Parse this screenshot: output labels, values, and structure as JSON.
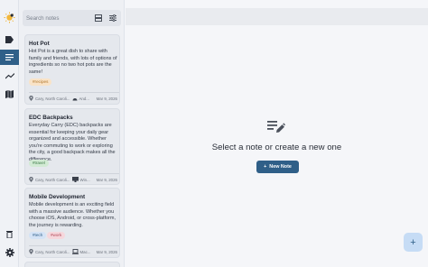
{
  "search": {
    "placeholder": "Search notes"
  },
  "notes": [
    {
      "title": "Hot Pot",
      "body": "Hot Pot is a great dish to share with family and friends, with lots of options of ingredients so no two hot pots are the same!",
      "tags": [
        {
          "label": "#recipes",
          "bg": "#f9e3c7",
          "fg": "#b0762c"
        }
      ],
      "location": "Cary, North Caroli...",
      "device": "And...",
      "date": "Mar 9, 2026"
    },
    {
      "title": "EDC Backpacks",
      "body": "Everyday Carry (EDC) backpacks are essential for keeping your daily gear organized and accessible. Whether you're commuting to work or exploring the city, a good backpack makes all the difference.",
      "tags": [
        {
          "label": "#travel",
          "bg": "#d2ead4",
          "fg": "#3b7a45"
        }
      ],
      "location": "Cary, North Caroli...",
      "device": "Win...",
      "date": "Mar 9, 2026"
    },
    {
      "title": "Mobile Development",
      "body": "Mobile development is an exciting field with a massive audience. Whether you choose iOS, Android, or cross-platform, the journey is rewarding.",
      "tags": [
        {
          "label": "#tech",
          "bg": "#d4e3f6",
          "fg": "#2f5f88"
        },
        {
          "label": "#work",
          "bg": "#f6d7dc",
          "fg": "#b04656"
        }
      ],
      "location": "Cary, North Caroli...",
      "device": "Mac...",
      "date": "Mar 9, 2026"
    }
  ],
  "main": {
    "empty_text": "Select a note or create a new one",
    "new_note_label": "New Note"
  },
  "colors": {
    "accent": "#2f5f88",
    "fab": "#c6dcf5"
  }
}
